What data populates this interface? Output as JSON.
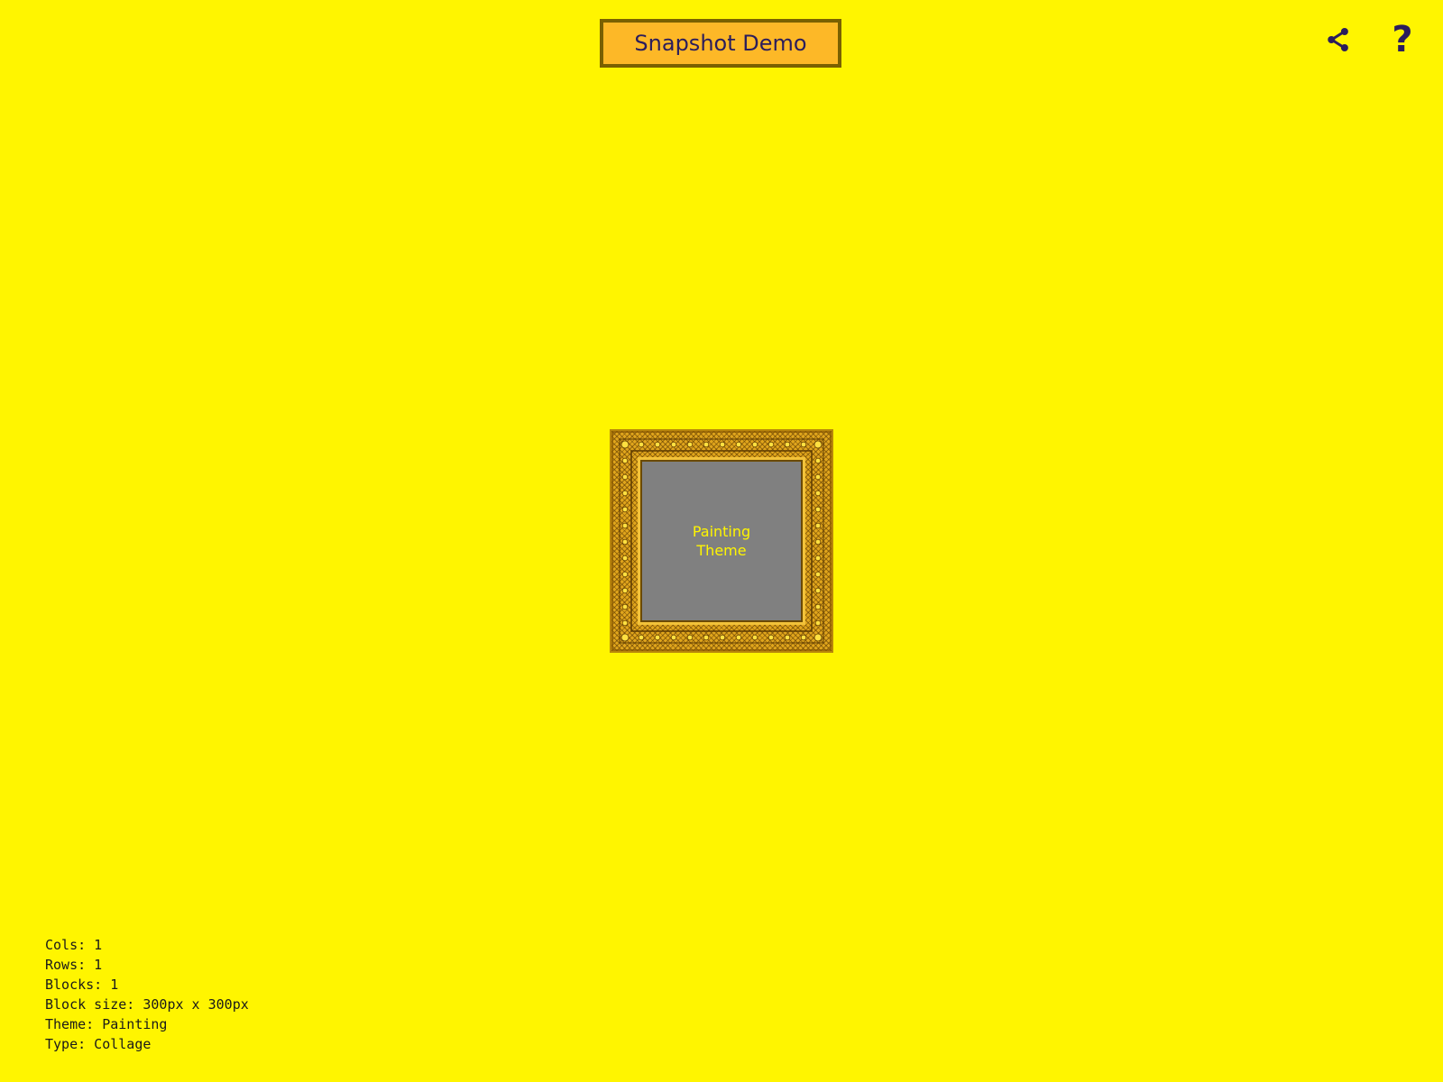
{
  "header": {
    "title_button": "Snapshot Demo",
    "share_icon": "share-icon",
    "help_glyph": "?"
  },
  "block": {
    "label_line1": "Painting",
    "label_line2": "Theme"
  },
  "info": {
    "cols": "Cols: 1",
    "rows": "Rows: 1",
    "blocks": "Blocks: 1",
    "block_size": "Block size: 300px x 300px",
    "theme": "Theme: Painting",
    "type": "Type: Collage"
  },
  "colors": {
    "background": "#FFF500",
    "title_button_bg": "#FDB827",
    "title_button_border": "#7A6100",
    "title_text": "#2B1D5C",
    "canvas_gray": "#808080",
    "frame_gold": "#E0A51C"
  }
}
